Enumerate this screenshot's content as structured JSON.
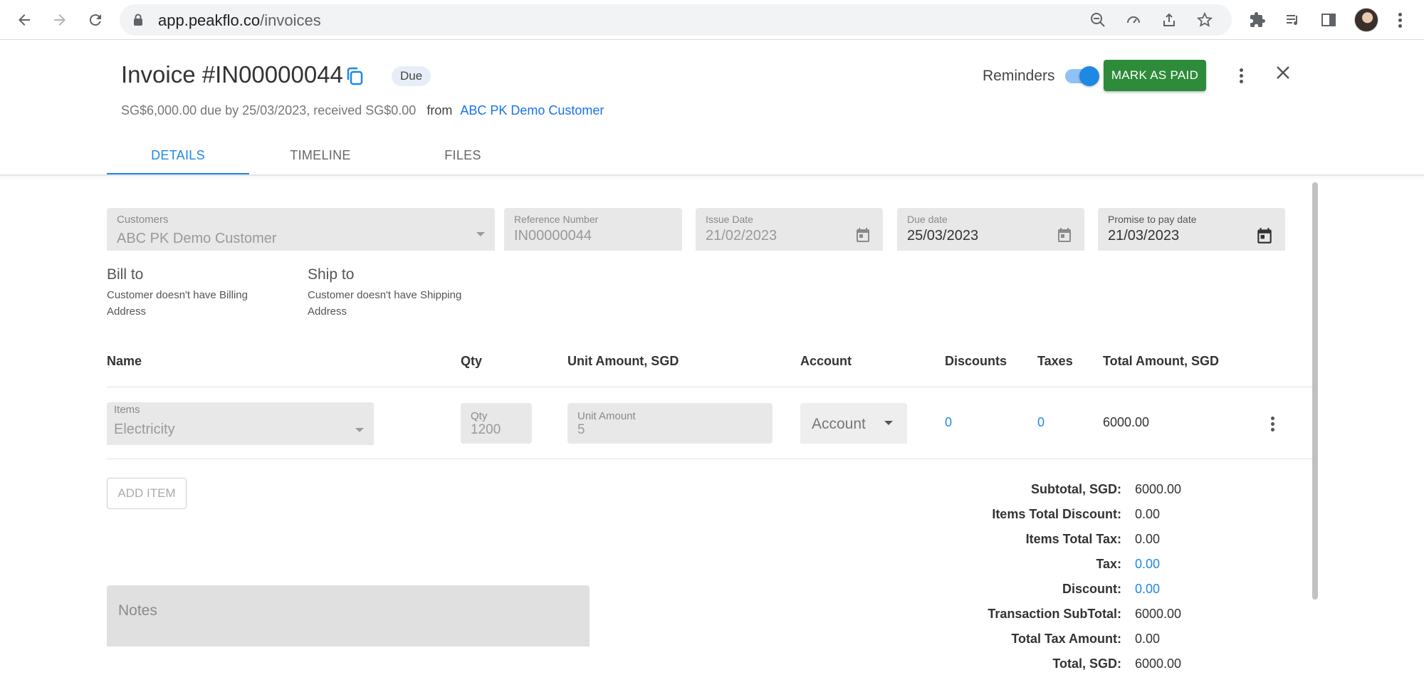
{
  "browser": {
    "url_host": "app.peakflo.co",
    "url_path": "/invoices"
  },
  "header": {
    "title": "Invoice #IN00000044",
    "status_badge": "Due",
    "summary": "SG$6,000.00 due by 25/03/2023, received SG$0.00",
    "from_label": "from",
    "customer_link": "ABC PK Demo Customer",
    "reminders_label": "Reminders",
    "reminders_on": true,
    "mark_paid_label": "MARK AS PAID"
  },
  "tabs": [
    {
      "label": "DETAILS",
      "active": true
    },
    {
      "label": "TIMELINE",
      "active": false
    },
    {
      "label": "FILES",
      "active": false
    }
  ],
  "form": {
    "customers": {
      "label": "Customers",
      "value": "ABC PK Demo Customer"
    },
    "reference": {
      "label": "Reference Number",
      "value": "IN00000044"
    },
    "issue_date": {
      "label": "Issue Date",
      "value": "21/02/2023"
    },
    "due_date": {
      "label": "Due date",
      "value": "25/03/2023"
    },
    "promise_date": {
      "label": "Promise to pay date",
      "value": "21/03/2023"
    }
  },
  "bill_to": {
    "title": "Bill to",
    "line1": "Customer doesn't have Billing",
    "line2": "Address"
  },
  "ship_to": {
    "title": "Ship to",
    "line1": "Customer doesn't have Shipping",
    "line2": "Address"
  },
  "table": {
    "headers": [
      "Name",
      "Qty",
      "Unit Amount, SGD",
      "Account",
      "Discounts",
      "Taxes",
      "Total Amount, SGD"
    ],
    "row": {
      "items_label": "Items",
      "items_value": "Electricity",
      "qty_label": "Qty",
      "qty_value": "1200",
      "unit_label": "Unit Amount",
      "unit_value": "5",
      "account_placeholder": "Account",
      "discounts": "0",
      "taxes": "0",
      "total": "6000.00"
    }
  },
  "add_item_label": "ADD ITEM",
  "totals": [
    {
      "label": "Subtotal, SGD:",
      "value": "6000.00",
      "link": false
    },
    {
      "label": "Items Total Discount:",
      "value": "0.00",
      "link": false
    },
    {
      "label": "Items Total Tax:",
      "value": "0.00",
      "link": false
    },
    {
      "label": "Tax:",
      "value": "0.00",
      "link": true
    },
    {
      "label": "Discount:",
      "value": "0.00",
      "link": true
    },
    {
      "label": "Transaction SubTotal:",
      "value": "6000.00",
      "link": false
    },
    {
      "label": "Total Tax Amount:",
      "value": "0.00",
      "link": false
    },
    {
      "label": "Total, SGD:",
      "value": "6000.00",
      "link": false
    }
  ],
  "notes_placeholder": "Notes",
  "colors": {
    "accent": "#1e88e5",
    "primary_button": "#2e8b3a",
    "field_bg": "#e8e8e8"
  }
}
